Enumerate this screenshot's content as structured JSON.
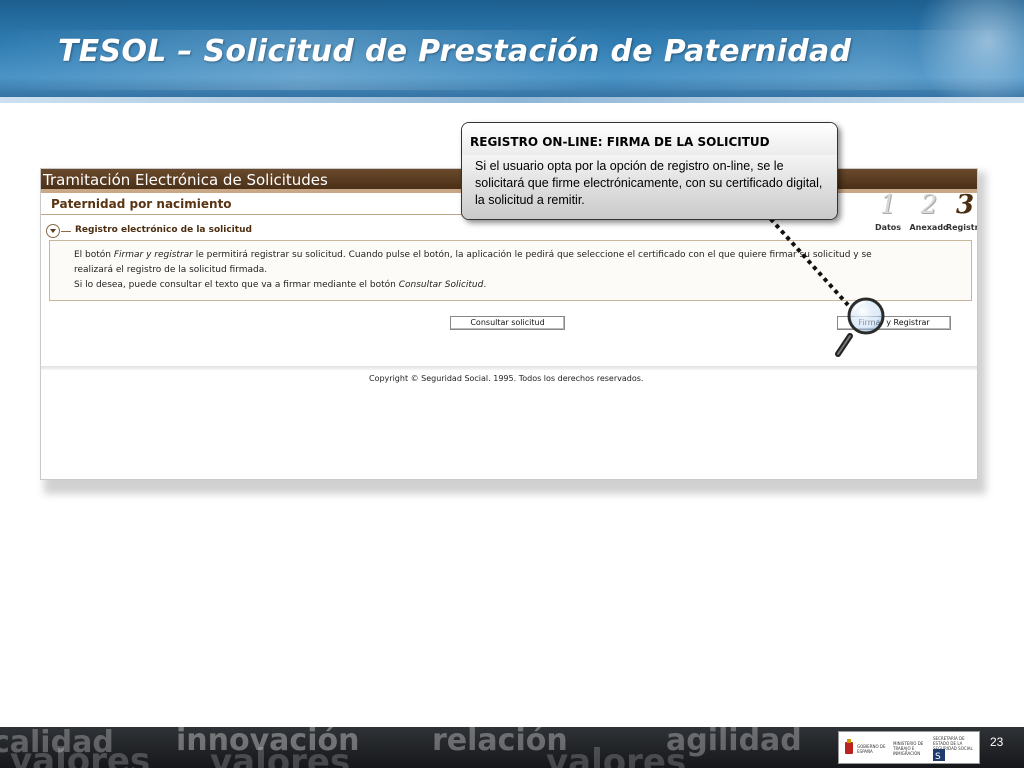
{
  "slide": {
    "title": "TESOL – Solicitud de Prestación de Paternidad",
    "page_number": "23"
  },
  "screenshot": {
    "app_title": "Tramitación Electrónica de Solicitudes",
    "section_title": "Paternidad por nacimiento",
    "steps": [
      {
        "number": "1",
        "label": "Datos",
        "state": "inactive"
      },
      {
        "number": "2",
        "label": "Anexado",
        "state": "inactive"
      },
      {
        "number": "3",
        "label": "Registro",
        "state": "active"
      }
    ],
    "subsection_title": "Registro electrónico de la solicitud",
    "info": {
      "line1_pre": "El botón ",
      "line1_italic": "Firmar y registrar",
      "line1_post": " le permitirá registrar su solicitud. Cuando pulse el botón, la aplicación le pedirá que seleccione el certificado con el que quiere firmar su solicitud y se",
      "line2": "realizará el registro de la solicitud firmada.",
      "line3_pre": "Si lo desea, puede consultar el texto que va a firmar mediante el botón ",
      "line3_italic": "Consultar Solicitud",
      "line3_post": "."
    },
    "buttons": {
      "consultar": "Consultar solicitud",
      "firmar": "Firmar y Registrar"
    },
    "copyright": "Copyright © Seguridad Social. 1995. Todos los derechos reservados."
  },
  "callout": {
    "title": "REGISTRO ON-LINE: FIRMA DE LA SOLICITUD",
    "text": "Si el usuario opta por la opción de registro on-line, se le solicitará que firme electrónicamente, con su certificado digital, la solicitud a remitir."
  },
  "footer": {
    "words": [
      "calidad",
      "valores",
      "innovación",
      "valores",
      "relación",
      "valores",
      "agilidad"
    ],
    "logos": [
      "GOBIERNO DE ESPAÑA",
      "MINISTERIO DE TRABAJO E INMIGRACIÓN",
      "SECRETARÍA DE ESTADO DE LA SEGURIDAD SOCIAL"
    ]
  },
  "colors": {
    "header_blue": "#2e7bb1",
    "app_bar_brown": "#5a3a1e",
    "accent_brown": "#4b2d10"
  }
}
